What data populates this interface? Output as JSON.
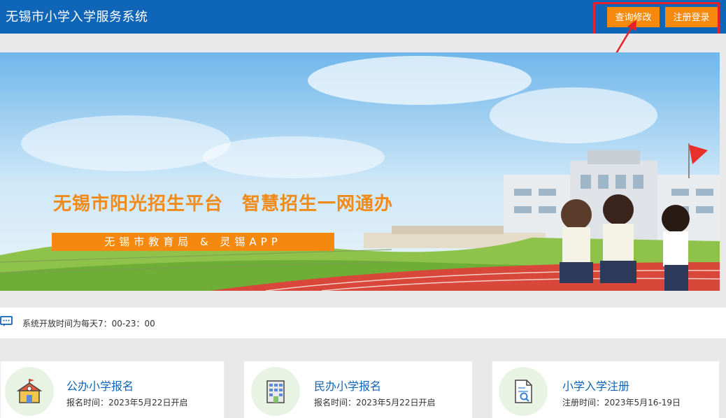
{
  "header": {
    "title": "无锡市小学入学服务系统",
    "query_button": "查询修改",
    "register_button": "注册登录"
  },
  "banner": {
    "headline": "无锡市阳光招生平台　智慧招生一网通办",
    "subline": "无锡市教育局 & 灵锡APP"
  },
  "notice": {
    "icon": "chat-icon",
    "text": "系统开放时间为每天7：00-23：00"
  },
  "cards": [
    {
      "icon": "school-icon",
      "title": "公办小学报名",
      "subtitle": "报名时间：2023年5月22日开启"
    },
    {
      "icon": "building-icon",
      "title": "民办小学报名",
      "subtitle": "报名时间：2023年5月22日开启"
    },
    {
      "icon": "document-search-icon",
      "title": "小学入学注册",
      "subtitle": "注册时间：2023年5月16-19日"
    }
  ],
  "colors": {
    "header_bg": "#0f65b7",
    "accent_orange": "#f58a0e",
    "highlight_red": "#e8202a"
  }
}
